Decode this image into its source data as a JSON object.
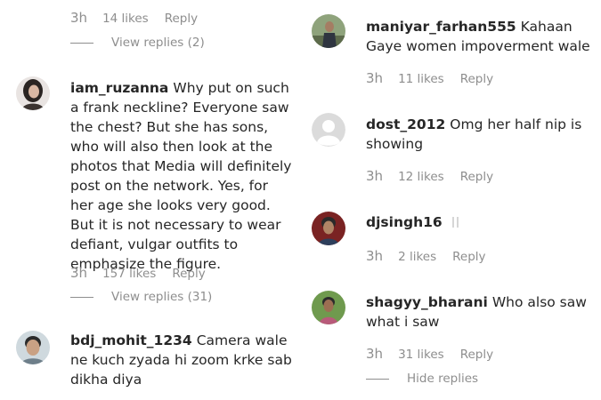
{
  "left": [
    {
      "meta": {
        "time": "3h",
        "likes": "14 likes",
        "reply": "Reply"
      },
      "replies_toggle": "View replies (2)"
    },
    {
      "username": "iam_ruzanna",
      "text": "Why put on such a frank neckline? Everyone saw the chest? But she has sons, who will also then look at the photos that Media will definitely post on the network. Yes, for her age she looks very good. But it is not necessary to wear defiant, vulgar outfits to emphasize the figure.",
      "meta": {
        "time": "3h",
        "likes": "157 likes",
        "reply": "Reply"
      },
      "replies_toggle": "View replies (31)"
    },
    {
      "username": "bdj_mohit_1234",
      "text": "Camera wale ne kuch zyada hi zoom krke sab dikha diya"
    }
  ],
  "right": [
    {
      "username": "maniyar_farhan555",
      "text": "Kahaan Gaye women impoverment wale",
      "meta": {
        "time": "3h",
        "likes": "11 likes",
        "reply": "Reply"
      }
    },
    {
      "username": "dost_2012",
      "text": "Omg her half nip is showing",
      "meta": {
        "time": "3h",
        "likes": "12 likes",
        "reply": "Reply"
      }
    },
    {
      "username": "djsingh16",
      "text": "",
      "meta": {
        "time": "3h",
        "likes": "2 likes",
        "reply": "Reply"
      }
    },
    {
      "username": "shagyy_bharani",
      "text": "Who also saw what i saw",
      "meta": {
        "time": "3h",
        "likes": "31 likes",
        "reply": "Reply"
      },
      "replies_toggle": "Hide replies"
    }
  ],
  "colors": {
    "text": "#262626",
    "muted": "#8e8e8e",
    "background": "#ffffff"
  }
}
